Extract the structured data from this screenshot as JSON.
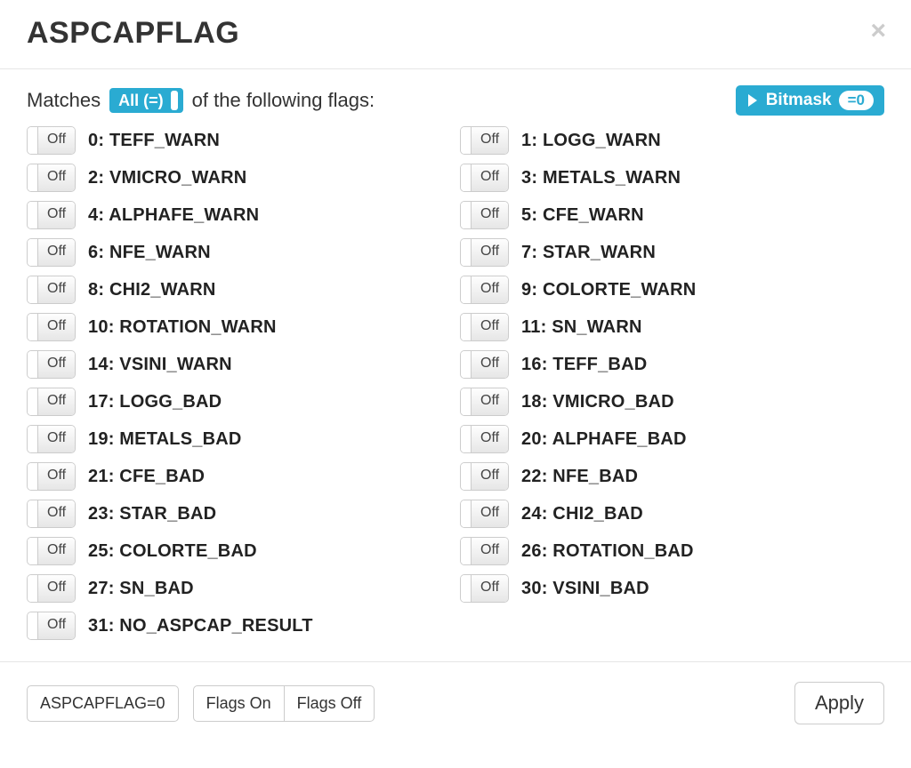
{
  "title": "ASPCAPFLAG",
  "close_glyph": "×",
  "matches": {
    "prefix": "Matches",
    "toggle_label": "All (=)",
    "suffix": "of the following flags:"
  },
  "bitmask": {
    "label": "Bitmask",
    "pill": "=0"
  },
  "flag_off_label": "Off",
  "flags": [
    {
      "bit": 0,
      "name": "TEFF_WARN",
      "state": "Off"
    },
    {
      "bit": 1,
      "name": "LOGG_WARN",
      "state": "Off"
    },
    {
      "bit": 2,
      "name": "VMICRO_WARN",
      "state": "Off"
    },
    {
      "bit": 3,
      "name": "METALS_WARN",
      "state": "Off"
    },
    {
      "bit": 4,
      "name": "ALPHAFE_WARN",
      "state": "Off"
    },
    {
      "bit": 5,
      "name": "CFE_WARN",
      "state": "Off"
    },
    {
      "bit": 6,
      "name": "NFE_WARN",
      "state": "Off"
    },
    {
      "bit": 7,
      "name": "STAR_WARN",
      "state": "Off"
    },
    {
      "bit": 8,
      "name": "CHI2_WARN",
      "state": "Off"
    },
    {
      "bit": 9,
      "name": "COLORTE_WARN",
      "state": "Off"
    },
    {
      "bit": 10,
      "name": "ROTATION_WARN",
      "state": "Off"
    },
    {
      "bit": 11,
      "name": "SN_WARN",
      "state": "Off"
    },
    {
      "bit": 14,
      "name": "VSINI_WARN",
      "state": "Off"
    },
    {
      "bit": 16,
      "name": "TEFF_BAD",
      "state": "Off"
    },
    {
      "bit": 17,
      "name": "LOGG_BAD",
      "state": "Off"
    },
    {
      "bit": 18,
      "name": "VMICRO_BAD",
      "state": "Off"
    },
    {
      "bit": 19,
      "name": "METALS_BAD",
      "state": "Off"
    },
    {
      "bit": 20,
      "name": "ALPHAFE_BAD",
      "state": "Off"
    },
    {
      "bit": 21,
      "name": "CFE_BAD",
      "state": "Off"
    },
    {
      "bit": 22,
      "name": "NFE_BAD",
      "state": "Off"
    },
    {
      "bit": 23,
      "name": "STAR_BAD",
      "state": "Off"
    },
    {
      "bit": 24,
      "name": "CHI2_BAD",
      "state": "Off"
    },
    {
      "bit": 25,
      "name": "COLORTE_BAD",
      "state": "Off"
    },
    {
      "bit": 26,
      "name": "ROTATION_BAD",
      "state": "Off"
    },
    {
      "bit": 27,
      "name": "SN_BAD",
      "state": "Off"
    },
    {
      "bit": 30,
      "name": "VSINI_BAD",
      "state": "Off"
    },
    {
      "bit": 31,
      "name": "NO_ASPCAP_RESULT",
      "state": "Off"
    }
  ],
  "footer": {
    "expr": "ASPCAPFLAG=0",
    "flags_on": "Flags On",
    "flags_off": "Flags Off",
    "apply": "Apply"
  }
}
